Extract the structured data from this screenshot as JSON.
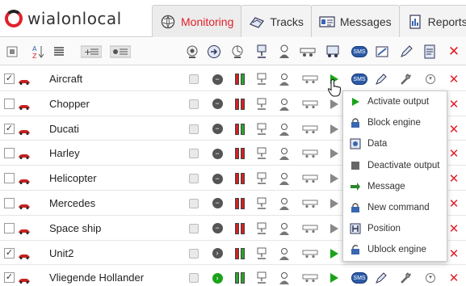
{
  "app": {
    "logo_text": "wialonlocal",
    "accent_color": "#e2202a"
  },
  "tabs": [
    {
      "label": "Monitoring",
      "icon": "globe-icon",
      "active": true
    },
    {
      "label": "Tracks",
      "icon": "tracks-icon",
      "active": false
    },
    {
      "label": "Messages",
      "icon": "messages-icon",
      "active": false
    },
    {
      "label": "Reports",
      "icon": "reports-icon",
      "active": false
    }
  ],
  "toolbar": {
    "left_icons": [
      "select-all-icon",
      "sort-az-icon",
      "list-icon",
      "add-group-icon",
      "group-toggle-icon"
    ],
    "column_icons": [
      "visibility-icon",
      "movement-icon",
      "connection-icon",
      "sensor-icon",
      "driver-icon",
      "trailer-icon",
      "vehicle-icon",
      "sms-icon",
      "command-icon",
      "edit-icon",
      "report-icon",
      "delete-icon"
    ]
  },
  "units": [
    {
      "name": "Aircraft",
      "checked": true,
      "status": "stop",
      "bars": "red-green",
      "play": "green"
    },
    {
      "name": "Chopper",
      "checked": false,
      "status": "stop",
      "bars": "red-red",
      "play": "gray"
    },
    {
      "name": "Ducati",
      "checked": true,
      "status": "stop",
      "bars": "red-green",
      "play": "gray"
    },
    {
      "name": "Harley",
      "checked": false,
      "status": "stop",
      "bars": "red-red",
      "play": "gray"
    },
    {
      "name": "Helicopter",
      "checked": false,
      "status": "stop",
      "bars": "red-red",
      "play": "gray"
    },
    {
      "name": "Mercedes",
      "checked": false,
      "status": "stop",
      "bars": "red-red",
      "play": "gray"
    },
    {
      "name": "Space ship",
      "checked": false,
      "status": "stop",
      "bars": "red-red",
      "play": "gray"
    },
    {
      "name": "Unit2",
      "checked": true,
      "status": "moving",
      "bars": "red-green",
      "play": "green"
    },
    {
      "name": "Vliegende Hollander",
      "checked": true,
      "status": "moving-green",
      "bars": "green-green",
      "play": "green"
    }
  ],
  "context_menu": [
    {
      "label": "Activate output",
      "icon": "play-icon"
    },
    {
      "label": "Block engine",
      "icon": "lock-icon"
    },
    {
      "label": "Data",
      "icon": "data-icon"
    },
    {
      "label": "Deactivate output",
      "icon": "stop-icon"
    },
    {
      "label": "Message",
      "icon": "message-icon"
    },
    {
      "label": "New command",
      "icon": "lock-icon"
    },
    {
      "label": "Position",
      "icon": "position-icon"
    },
    {
      "label": "Ublock engine",
      "icon": "unlock-icon"
    }
  ],
  "sms_label": "SMS",
  "checkmark": "✓"
}
